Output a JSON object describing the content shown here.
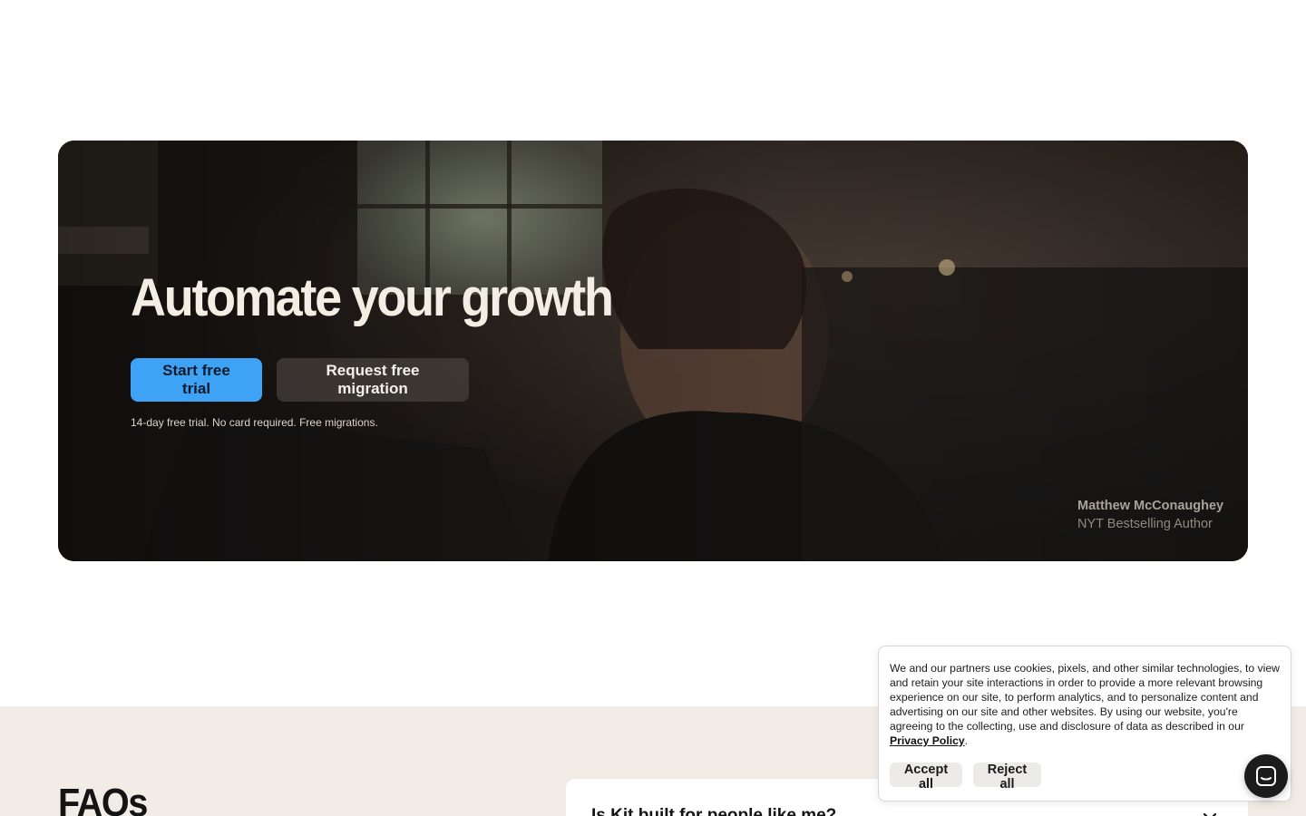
{
  "hero": {
    "title": "Automate your growth",
    "primary_cta": "Start free trial",
    "secondary_cta": "Request free migration",
    "note": "14-day free trial. No card required. Free migrations.",
    "testimonial_name": "Matthew McConaughey",
    "testimonial_role": "NYT Bestselling Author"
  },
  "faq": {
    "title": "FAQs",
    "first_question": "Is Kit built for people like me?"
  },
  "cookie_banner": {
    "text": "We and our partners use cookies, pixels, and other similar technologies, to view and retain your site interactions in order to provide a more relevant browsing experience on our site, to perform analytics, and to personalize content and advertising on our site and other websites. By using our website, you're agreeing to the collecting, use and disclosure of data as described in our",
    "policy_link": "Privacy Policy",
    "link_suffix": ".",
    "accept_label": "Accept all",
    "reject_label": "Reject all"
  },
  "icons": {
    "chevron": "chevron-down-icon",
    "chat": "chat-icon"
  },
  "colors": {
    "primary_cta": "#3fa3f5",
    "hero_background": "#221d1a",
    "faq_background": "#f1ede6",
    "chat_button": "#1c1c1c"
  }
}
